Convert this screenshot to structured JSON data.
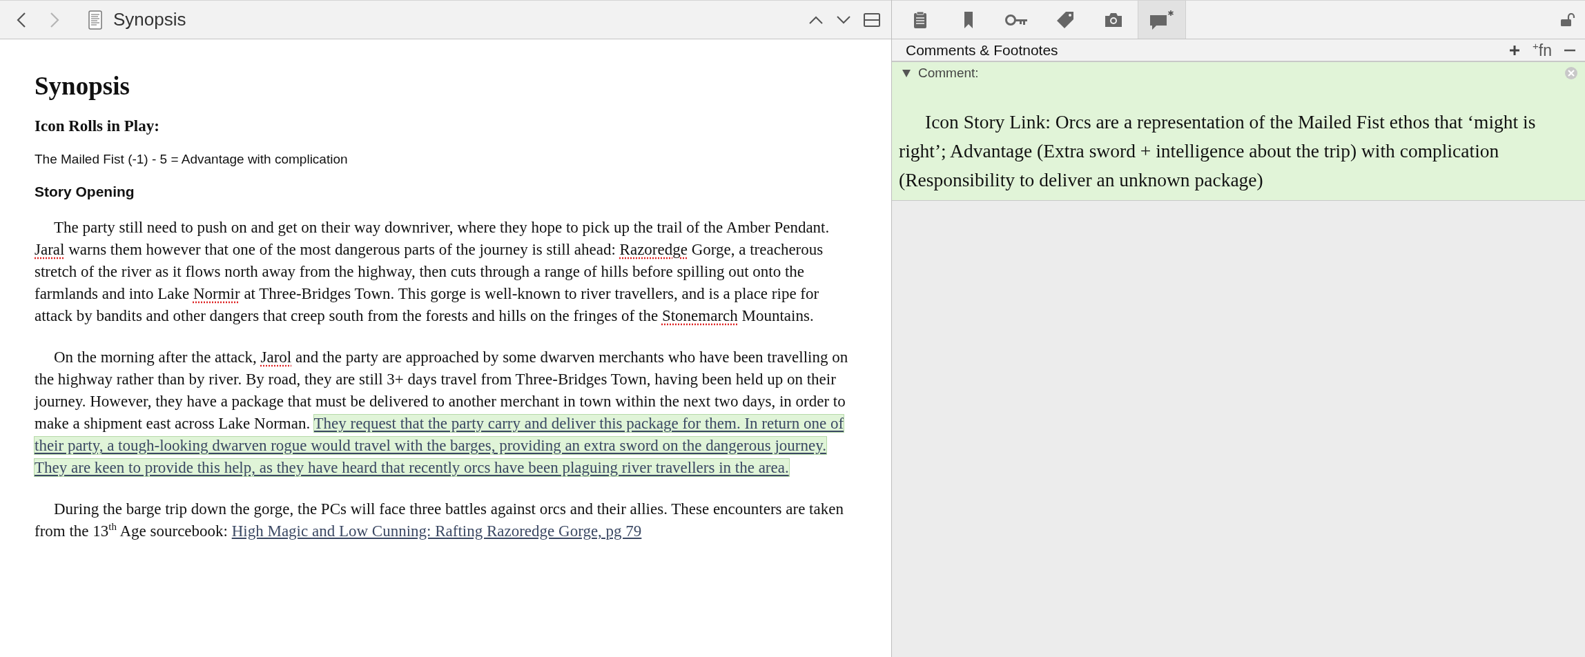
{
  "editor": {
    "nav": [
      {
        "kind": "back",
        "disabled": false
      },
      {
        "kind": "forward",
        "disabled": true
      }
    ],
    "title": "Synopsis",
    "blocks": [
      {
        "kind": "title",
        "text": "Synopsis"
      },
      {
        "kind": "heading",
        "text": "Icon Rolls in Play:"
      },
      {
        "kind": "plain",
        "text": "The Mailed Fist (-1) - 5 = Advantage with complication"
      },
      {
        "kind": "subheading",
        "text": "Story Opening"
      },
      {
        "kind": "paragraph",
        "segments": [
          {
            "kind": "text",
            "text": "The party still need to push on and get on their way downriver, where they hope to pick up the trail of the Amber Pendant. "
          },
          {
            "kind": "misspelled",
            "text": "Jaral"
          },
          {
            "kind": "text",
            "text": " warns them however that one of the most dangerous parts of the journey is still ahead: "
          },
          {
            "kind": "misspelled",
            "text": "Razoredge"
          },
          {
            "kind": "text",
            "text": " Gorge, a treacherous stretch of the river as it flows north away from the highway, then cuts through a range of hills before spilling out onto the farmlands and into Lake "
          },
          {
            "kind": "misspelled",
            "text": "Normir"
          },
          {
            "kind": "text",
            "text": " at Three-Bridges Town. This gorge is well-known to river travellers, and is a place ripe for attack by bandits and other dangers that creep south from the forests and hills on the fringes of the "
          },
          {
            "kind": "misspelled",
            "text": "Stonemarch"
          },
          {
            "kind": "text",
            "text": " Mountains."
          }
        ]
      },
      {
        "kind": "paragraph",
        "segments": [
          {
            "kind": "text",
            "text": "On the morning after the attack, "
          },
          {
            "kind": "misspelled",
            "text": "Jarol"
          },
          {
            "kind": "text",
            "text": " and the party are approached by some dwarven merchants who have been travelling on the highway rather than by river. By road, they are still 3+ days travel from Three-Bridges Town, having been held up on their journey. However, they have a package that must be delivered to another merchant in town within the next two days, in order to make a shipment east across Lake Norman. "
          },
          {
            "kind": "comment",
            "text": "They request that the party carry and deliver this package for them. In return one of their party, a tough-looking dwarven rogue would travel with the barges, providing an extra sword on the dangerous journey.  They are keen to provide this help, as they have heard that recently orcs have been plaguing river travellers in the area."
          }
        ]
      },
      {
        "kind": "paragraph",
        "segments": [
          {
            "kind": "text",
            "text": "During the barge trip down the gorge, the PCs will face three battles against orcs and their allies. These encounters are taken from the 13"
          },
          {
            "kind": "sup",
            "text": "th"
          },
          {
            "kind": "text",
            "text": " Age sourcebook: "
          },
          {
            "kind": "link",
            "text": "High Magic and Low Cunning: Rafting Razoredge Gorge, pg 79"
          }
        ]
      }
    ]
  },
  "inspector": {
    "tabs": [
      {
        "kind": "notes",
        "selected": false
      },
      {
        "kind": "bookmark",
        "selected": false
      },
      {
        "kind": "key",
        "selected": false
      },
      {
        "kind": "tag",
        "selected": false
      },
      {
        "kind": "camera",
        "selected": false
      },
      {
        "kind": "comment",
        "selected": true
      }
    ],
    "locked": false,
    "panel_title": "Comments & Footnotes",
    "actions": [
      {
        "kind": "add"
      },
      {
        "kind": "footnote",
        "label": "$^{+}$fn"
      },
      {
        "kind": "remove"
      }
    ],
    "comments": [
      {
        "label": "Comment:",
        "expanded": true,
        "text": "Icon Story Link: Orcs are a representation of the Mailed Fist ethos that ‘might is right’; Advantage (Extra sword + intelligence about the trip) with complication (Responsibility to deliver an unknown package)"
      }
    ]
  }
}
